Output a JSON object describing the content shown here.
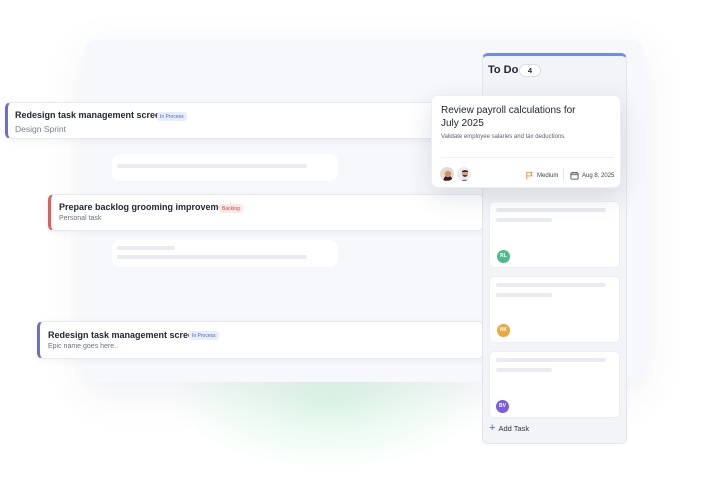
{
  "tasks": [
    {
      "title": "Redesign task management screens",
      "status": "In Process",
      "subtitle": "Design Sprint"
    },
    {
      "title": "Prepare backlog grooming improvements",
      "status": "Backlog",
      "subtitle": "Personal task"
    },
    {
      "title": "Redesign task management screens",
      "status": "In Process",
      "subtitle": "Epic name goes here.."
    }
  ],
  "column": {
    "title": "To Do",
    "count": "4",
    "featured": {
      "title": "Review payroll calculations for July 2025",
      "description": "Validate employee salaries and tax deductions.",
      "priority": "Medium",
      "due_date": "Aug 8, 2025"
    },
    "cards": [
      {
        "initials": "RL",
        "color": "#4dbb8a"
      },
      {
        "initials": "NK",
        "color": "#f0a63a"
      },
      {
        "initials": "BV",
        "color": "#7a5ce6"
      }
    ],
    "add_label": "Add Task"
  },
  "colors": {
    "accent_blue": "#6c8ee6",
    "priority_flag": "#f08a3c",
    "backlog_red": "#e65a5a"
  }
}
